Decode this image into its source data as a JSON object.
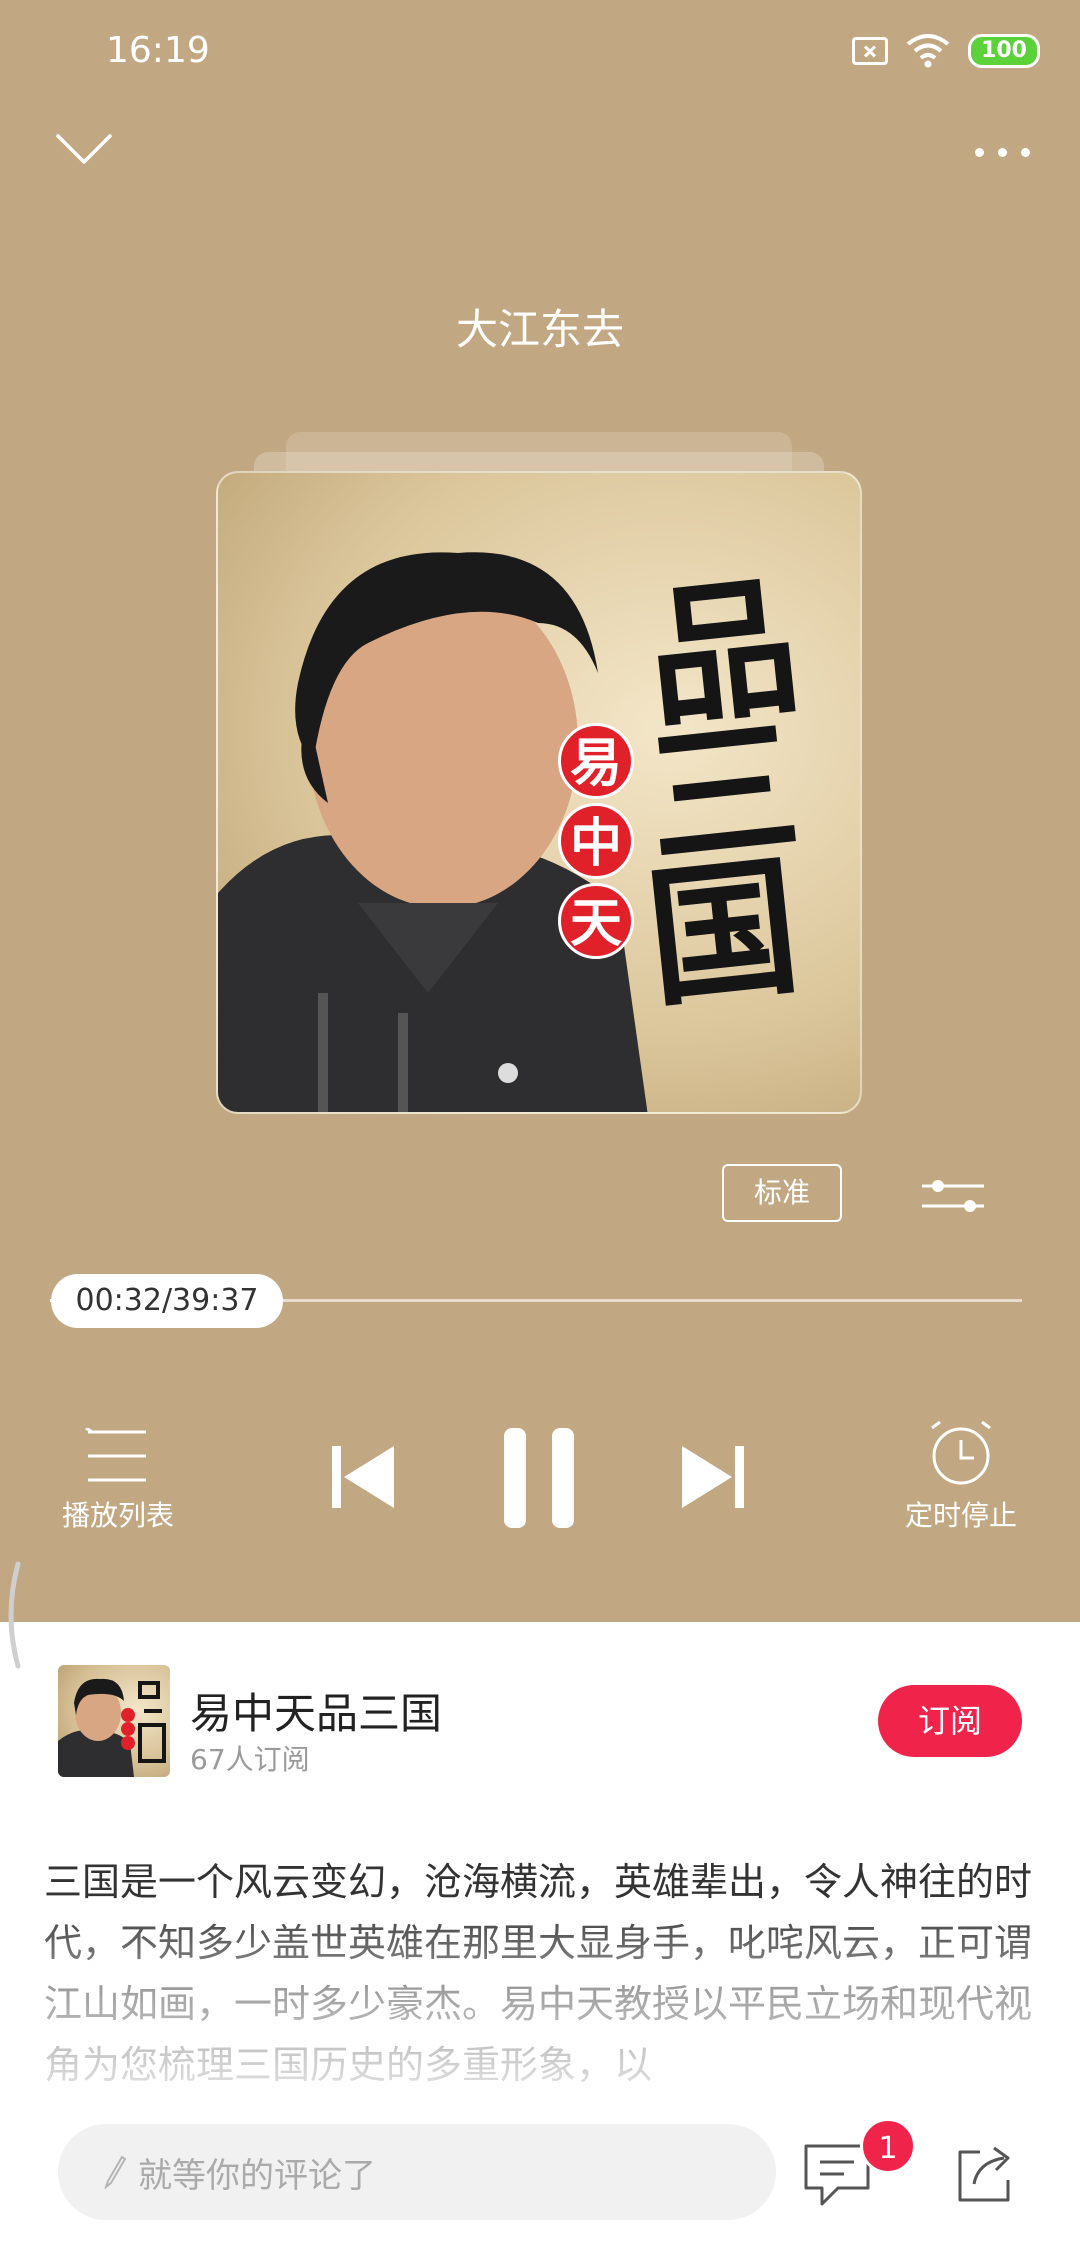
{
  "status_bar": {
    "time": "16:19",
    "battery": "100"
  },
  "player": {
    "track_title": "大江东去",
    "cover_text": {
      "seal_chars": [
        "易",
        "中",
        "天"
      ],
      "calligraphy": [
        "品",
        "三",
        "国"
      ]
    },
    "quality_label": "标准",
    "progress": {
      "text": "00:32/39:37",
      "fraction": 0.013
    },
    "playlist_label": "播放列表",
    "timer_label": "定时停止",
    "state": "playing"
  },
  "album": {
    "name": "易中天品三国",
    "subscribers": "67人订阅",
    "subscribe_label": "订阅",
    "description": "三国是一个风云变幻，沧海横流，英雄辈出，令人神往的时代，不知多少盖世英雄在那里大显身手，叱咤风云，正可谓江山如画，一时多少豪杰。易中天教授以平民立场和现代视角为您梳理三国历史的多重形象，以"
  },
  "bottom_bar": {
    "comment_placeholder": "就等你的评论了",
    "comment_count": "1"
  },
  "colors": {
    "player_bg": "#c2a882",
    "accent": "#f0244a"
  }
}
